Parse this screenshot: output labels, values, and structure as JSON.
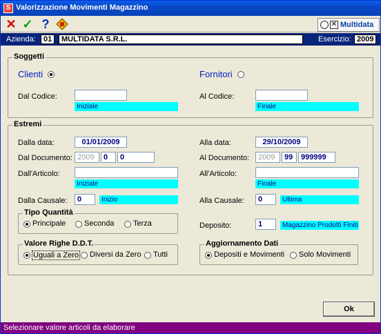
{
  "window": {
    "title": "Valorizzazione Movimenti Magazzino",
    "app_icon": "S"
  },
  "toolbar": {
    "icons": [
      "close-red-x-icon",
      "confirm-green-check-icon",
      "help-question-icon",
      "tools-diamond-icon"
    ],
    "logo_text": "Multidata"
  },
  "infobar": {
    "azienda_label": "Azienda:",
    "azienda_code": "01",
    "azienda_name": "MULTIDATA S.R.L.",
    "esercizio_label": "Esercizio:",
    "esercizio_value": "2009"
  },
  "soggetti": {
    "title": "Soggetti",
    "clienti_label": "Clienti",
    "fornitori_label": "Fornitori",
    "dal_codice_label": "Dal Codice:",
    "dal_codice_value": "",
    "dal_codice_desc": "Iniziale",
    "al_codice_label": "Al Codice:",
    "al_codice_value": "",
    "al_codice_desc": "Finale"
  },
  "estremi": {
    "title": "Estremi",
    "dalla_data_label": "Dalla data:",
    "dalla_data_value": "01/01/2009",
    "alla_data_label": "Alla data:",
    "alla_data_value": "29/10/2009",
    "dal_documento_label": "Dal Documento:",
    "dal_doc_anno": "2009",
    "dal_doc_serie": "0",
    "dal_doc_numero": "0",
    "al_documento_label": "Al Documento:",
    "al_doc_anno": "2009",
    "al_doc_serie": "99",
    "al_doc_numero": "999999",
    "dall_articolo_label": "Dall'Articolo:",
    "dall_articolo_desc": "Iniziale",
    "all_articolo_label": "All'Articolo:",
    "all_articolo_desc": "Finale",
    "dalla_causale_label": "Dalla Causale:",
    "dalla_causale_value": "0",
    "dalla_causale_desc": "Inizio",
    "alla_causale_label": "Alla Causale:",
    "alla_causale_value": "0",
    "alla_causale_desc": "Ultima",
    "deposito_label": "Deposito:",
    "deposito_value": "1",
    "deposito_desc": "Magazzino Prodotti Finiti"
  },
  "tipo_quantita": {
    "title": "Tipo Quantità",
    "options": [
      "Principale",
      "Seconda",
      "Terza"
    ],
    "selected": "Principale"
  },
  "valore_righe": {
    "title": "Valore Righe D.D.T.",
    "options": [
      "Uguali a Zero",
      "Diversi da Zero",
      "Tutti"
    ],
    "selected": "Uguali a Zero"
  },
  "aggiornamento": {
    "title": "Aggiornamento Dati",
    "options": [
      "Depositi e Movimenti",
      "Solo Movimenti"
    ],
    "selected": "Depositi e Movimenti"
  },
  "ok_button": "Ok",
  "status_text": "Selezionare valore articoli da elaborare"
}
